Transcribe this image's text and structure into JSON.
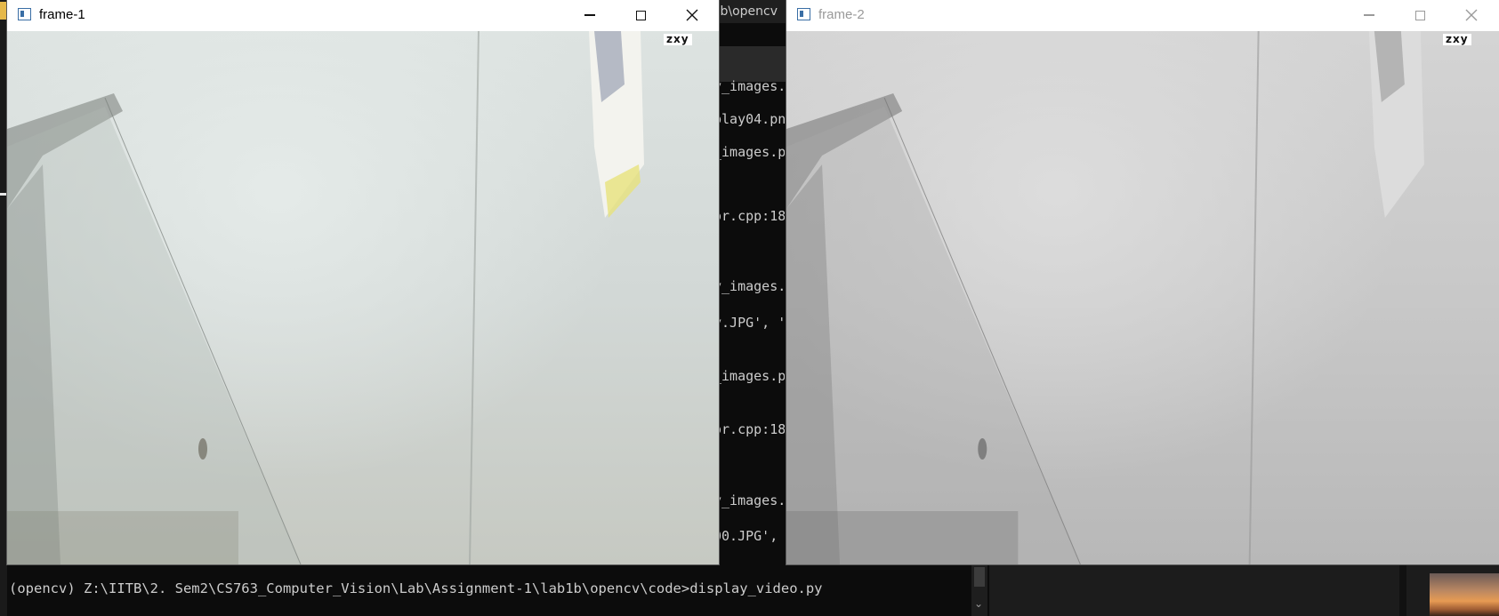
{
  "console": {
    "title_fragment": "o1b\\opencv",
    "lines": [
      "y_images.",
      "play04.pn",
      "_images.p",
      "or.cpp:18",
      "y_images.",
      "y.JPG', '",
      "_images.p",
      "or.cpp:18",
      "y_images.",
      "00.JPG',"
    ],
    "prompt": "(opencv) Z:\\IITB\\2. Sem2\\CS763_Computer_Vision\\Lab\\Assignment-1\\lab1b\\opencv\\code>display_video.py"
  },
  "windows": [
    {
      "title": "frame-1",
      "overlay_text": "zxy",
      "active": true,
      "color_mode": "color"
    },
    {
      "title": "frame-2",
      "overlay_text": "zxy",
      "active": false,
      "color_mode": "grayscale"
    }
  ],
  "icons": {
    "minimize": "minimize-icon",
    "maximize": "maximize-icon",
    "close": "close-icon",
    "app": "opencv-window-icon"
  }
}
